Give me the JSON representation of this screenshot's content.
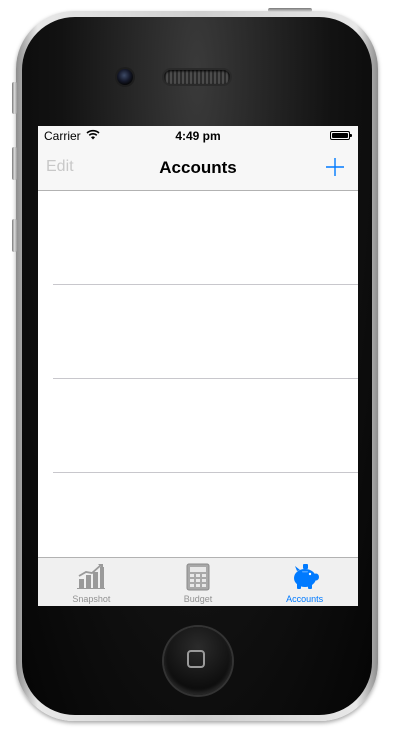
{
  "status_bar": {
    "carrier": "Carrier",
    "time": "4:49 pm"
  },
  "nav_bar": {
    "edit_label": "Edit",
    "title": "Accounts",
    "add_icon": "plus-icon"
  },
  "table": {
    "rows": [
      "",
      "",
      ""
    ]
  },
  "tab_bar": {
    "tabs": [
      {
        "label": "Snapshot",
        "icon": "chart-icon",
        "active": false
      },
      {
        "label": "Budget",
        "icon": "calculator-icon",
        "active": false
      },
      {
        "label": "Accounts",
        "icon": "piggy-bank-icon",
        "active": true
      }
    ]
  },
  "colors": {
    "accent": "#007aff",
    "inactive": "#929292",
    "disabled": "#c8c8c8"
  }
}
